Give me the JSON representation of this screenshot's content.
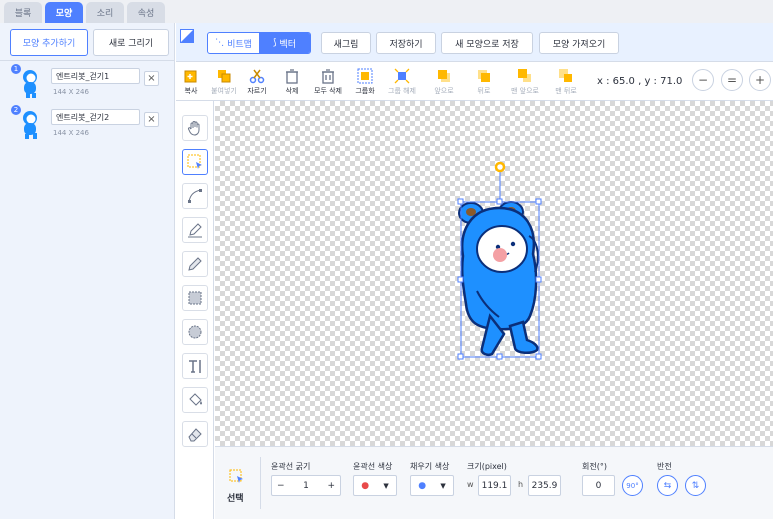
{
  "tabs": [
    "블록",
    "모양",
    "소리",
    "속성"
  ],
  "left_panel": {
    "add_shape": "모양 추가하기",
    "new_drawing": "새로 그리기",
    "items": [
      {
        "index": "1",
        "name": "엔트리봇_걷기1",
        "size": "144 X 246"
      },
      {
        "index": "2",
        "name": "엔트리봇_걷기2",
        "size": "144 X 246"
      }
    ]
  },
  "topbar": {
    "bitmap": "비트맵",
    "vector": "벡터",
    "new_picture": "새그림",
    "save": "저장하기",
    "save_as_new": "새 모양으로 저장",
    "import_shape": "모양 가져오기"
  },
  "toolbar": {
    "copy": "복사",
    "paste": "붙여넣기",
    "cut": "자르기",
    "delete": "삭제",
    "delete_all": "모두 삭제",
    "group": "그룹화",
    "ungroup": "그룹 해제",
    "front": "앞으로",
    "back": "뒤로",
    "frontmost": "맨 앞으로",
    "backmost": "맨 뒤로",
    "coords": "x : 65.0 , y : 71.0"
  },
  "zoom": {
    "minus": "−",
    "reset": "=",
    "plus": "+"
  },
  "bottom": {
    "mode": "선택",
    "stroke_width_label": "윤곽선 굵기",
    "stroke_width": "1",
    "stroke_color_label": "윤곽선 색상",
    "fill_color_label": "채우기 색상",
    "size_label": "크기(pixel)",
    "w_label": "w",
    "w": "119.1",
    "h_label": "h",
    "h": "235.9",
    "rotation_label": "회전(°)",
    "rotation": "0",
    "rotate90": "90°",
    "flip_label": "반전",
    "minus": "−",
    "plus": "+"
  },
  "colors": {
    "accent": "#4f80ff",
    "character": "#1e90ff"
  }
}
